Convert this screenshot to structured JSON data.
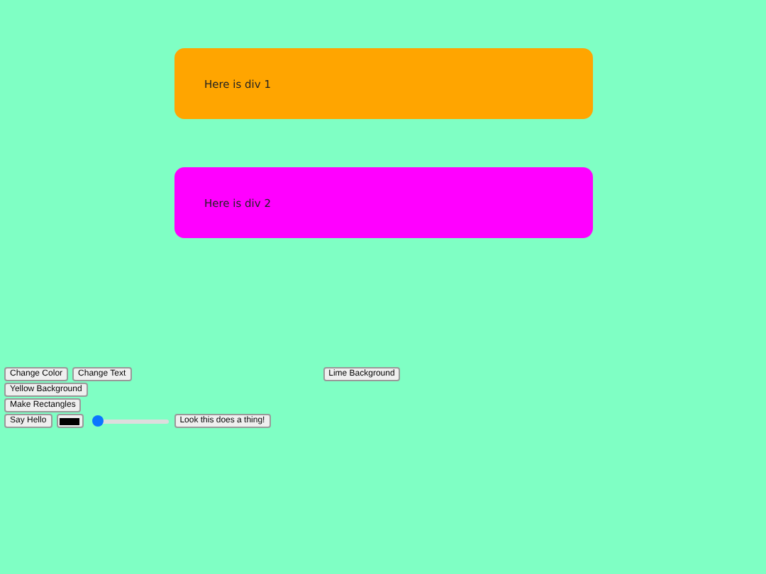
{
  "panels": [
    {
      "text": "Here is div 1",
      "color": "#ffa500"
    },
    {
      "text": "Here is div 2",
      "color": "#ff00ff"
    }
  ],
  "control_rows": [
    [
      {
        "kind": "button",
        "label": "Change Color"
      },
      {
        "kind": "button",
        "label": "Change Text"
      },
      {
        "kind": "spacer"
      },
      {
        "kind": "button",
        "label": "Lime Background"
      }
    ],
    [
      {
        "kind": "button",
        "label": "Yellow Background"
      }
    ],
    [
      {
        "kind": "button",
        "label": "Make Rectangles"
      }
    ],
    [
      {
        "kind": "button",
        "label": "Say Hello"
      },
      {
        "kind": "color",
        "color": "#000000"
      },
      {
        "kind": "slider",
        "level": 0.05
      },
      {
        "kind": "button",
        "label": "Look this does a thing!"
      }
    ]
  ]
}
